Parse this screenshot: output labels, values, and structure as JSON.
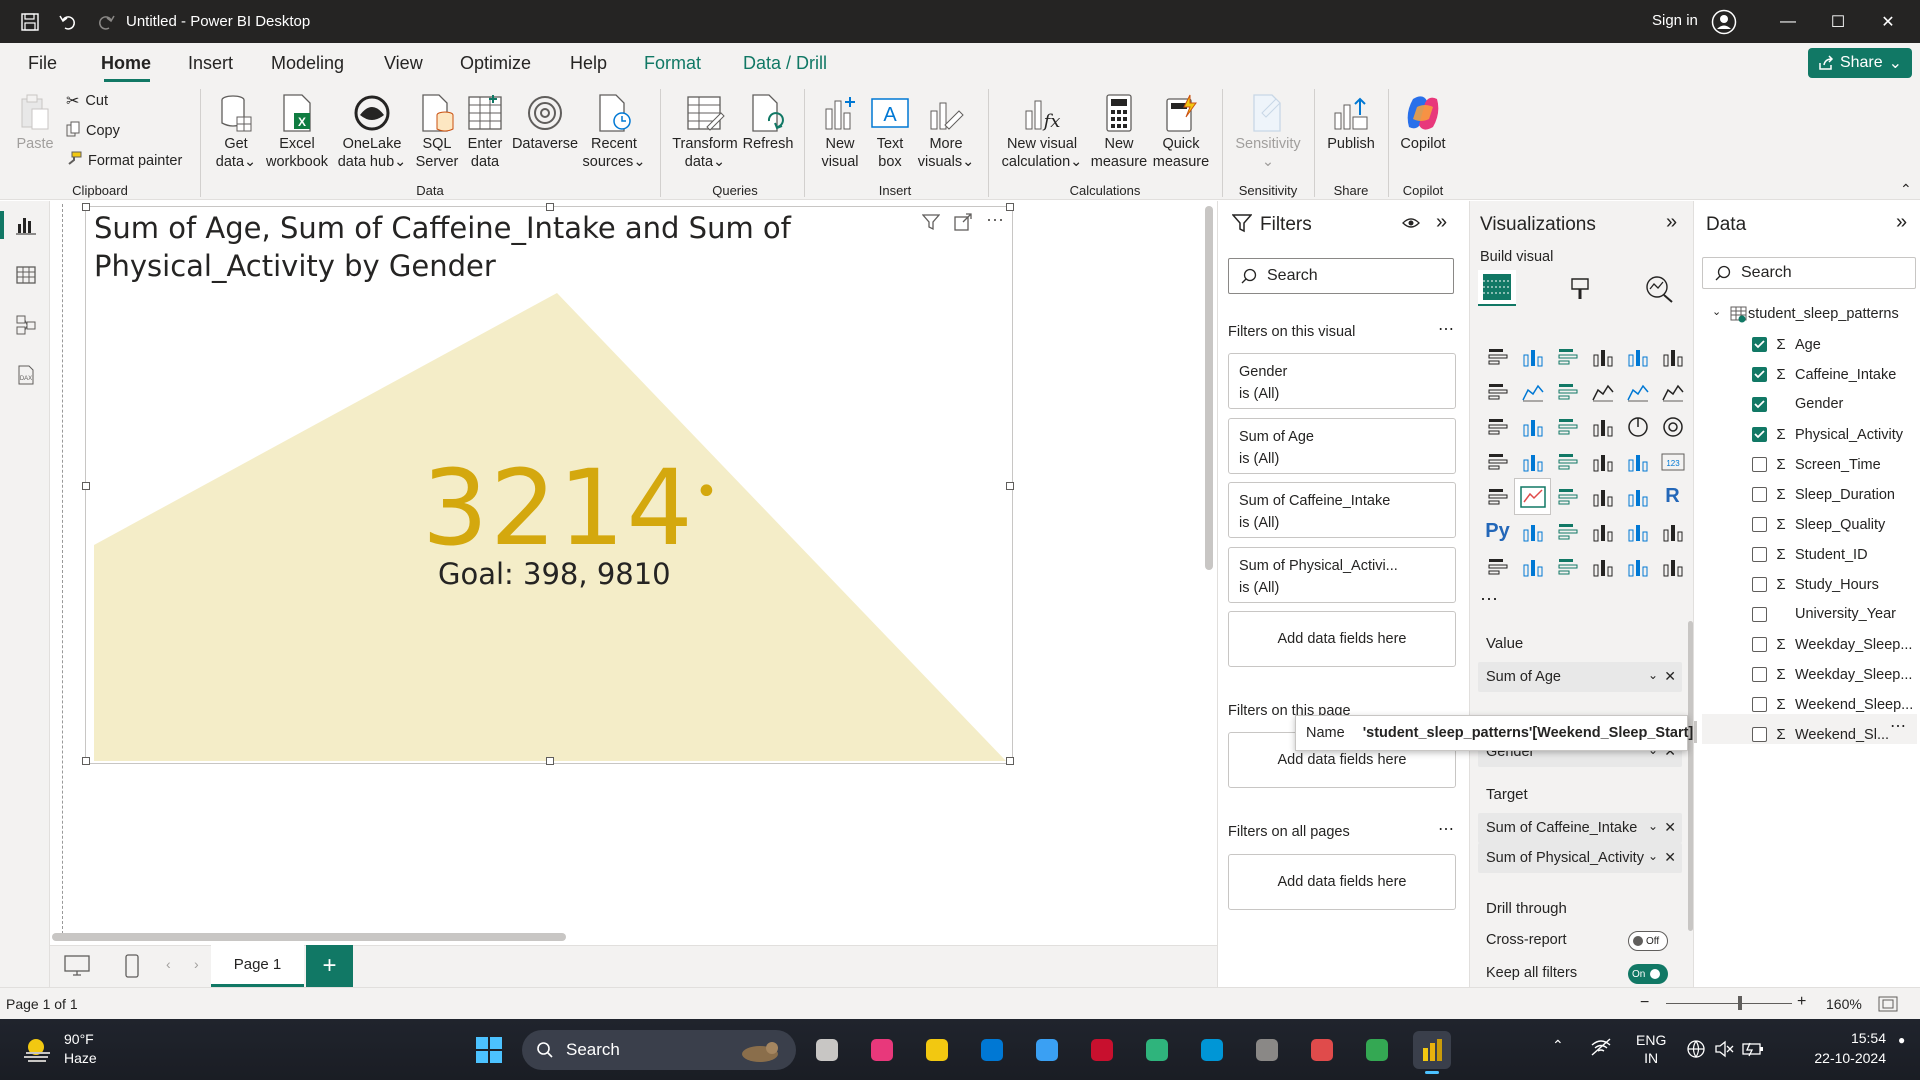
{
  "app": {
    "title": "Untitled - Power BI Desktop",
    "signin": "Sign in",
    "share": "Share"
  },
  "menu": {
    "tabs": [
      "File",
      "Home",
      "Insert",
      "Modeling",
      "View",
      "Optimize",
      "Help",
      "Format",
      "Data / Drill"
    ]
  },
  "ribbon": {
    "clipboard": {
      "paste": "Paste",
      "cut": "Cut",
      "copy": "Copy",
      "format_painter": "Format painter",
      "group": "Clipboard"
    },
    "data": {
      "get_data": [
        "Get",
        "data"
      ],
      "excel": [
        "Excel",
        "workbook"
      ],
      "onelake": [
        "OneLake",
        "data hub"
      ],
      "sql": [
        "SQL",
        "Server"
      ],
      "enter": [
        "Enter",
        "data"
      ],
      "dataverse": "Dataverse",
      "recent": [
        "Recent",
        "sources"
      ],
      "group": "Data"
    },
    "queries": {
      "transform": [
        "Transform",
        "data"
      ],
      "refresh": "Refresh",
      "group": "Queries"
    },
    "insert": {
      "new_visual": [
        "New",
        "visual"
      ],
      "text_box": [
        "Text",
        "box"
      ],
      "more_visuals": [
        "More",
        "visuals"
      ],
      "group": "Insert"
    },
    "calculations": {
      "new_calc": [
        "New visual",
        "calculation"
      ],
      "new_measure": [
        "New",
        "measure"
      ],
      "quick_measure": [
        "Quick",
        "measure"
      ],
      "group": "Calculations"
    },
    "sensitivity": {
      "label": "Sensitivity",
      "group": "Sensitivity"
    },
    "share": {
      "publish": "Publish",
      "group": "Share"
    },
    "copilot": {
      "label": "Copilot",
      "group": "Copilot"
    }
  },
  "visual": {
    "title": "Sum of Age, Sum of Caffeine_Intake and Sum of Physical_Activity by Gender",
    "kpi_value": "3214",
    "goal_text": "Goal: 398, 9810",
    "colors": {
      "kpi": "#D4A80E",
      "fill": "#F4EDC8"
    }
  },
  "pages": {
    "tab": "Page 1",
    "status": "Page 1 of 1",
    "zoom": "160%"
  },
  "filters": {
    "title": "Filters",
    "search": "Search",
    "on_visual": "Filters on this visual",
    "cards": [
      {
        "name": "Gender",
        "state": "is (All)"
      },
      {
        "name": "Sum of Age",
        "state": "is (All)"
      },
      {
        "name": "Sum of Caffeine_Intake",
        "state": "is (All)"
      },
      {
        "name": "Sum of Physical_Activi...",
        "state": "is (All)"
      }
    ],
    "add_fields": "Add data fields here",
    "on_page": "Filters on this page",
    "on_all": "Filters on all pages"
  },
  "visualizations": {
    "title": "Visualizations",
    "build": "Build visual",
    "value_label": "Value",
    "value_field": "Sum of Age",
    "trend_field": "Gender",
    "target_label": "Target",
    "target_fields": [
      "Sum of Caffeine_Intake",
      "Sum of Physical_Activity"
    ],
    "drill": "Drill through",
    "cross_report": "Cross-report",
    "cross_state": "Off",
    "keep_filters": "Keep all filters",
    "keep_state": "On"
  },
  "data": {
    "title": "Data",
    "search": "Search",
    "table": "student_sleep_patterns",
    "fields": [
      {
        "name": "Age",
        "checked": true,
        "sigma": true
      },
      {
        "name": "Caffeine_Intake",
        "checked": true,
        "sigma": true
      },
      {
        "name": "Gender",
        "checked": true,
        "sigma": false
      },
      {
        "name": "Physical_Activity",
        "checked": true,
        "sigma": true
      },
      {
        "name": "Screen_Time",
        "checked": false,
        "sigma": true
      },
      {
        "name": "Sleep_Duration",
        "checked": false,
        "sigma": true
      },
      {
        "name": "Sleep_Quality",
        "checked": false,
        "sigma": true
      },
      {
        "name": "Student_ID",
        "checked": false,
        "sigma": true
      },
      {
        "name": "Study_Hours",
        "checked": false,
        "sigma": true
      },
      {
        "name": "University_Year",
        "checked": false,
        "sigma": false
      },
      {
        "name": "Weekday_Sleep...",
        "checked": false,
        "sigma": true
      },
      {
        "name": "Weekday_Sleep...",
        "checked": false,
        "sigma": true
      },
      {
        "name": "Weekend_Sleep...",
        "checked": false,
        "sigma": true
      },
      {
        "name": "Weekend_Sl...",
        "checked": false,
        "sigma": true
      }
    ]
  },
  "tooltip": {
    "label": "Name",
    "value": "'student_sleep_patterns'[Weekend_Sleep_Start]"
  },
  "taskbar": {
    "temp": "90°F",
    "weather": "Haze",
    "search": "Search",
    "lang": [
      "ENG",
      "IN"
    ],
    "time": "15:54",
    "date": "22-10-2024"
  }
}
